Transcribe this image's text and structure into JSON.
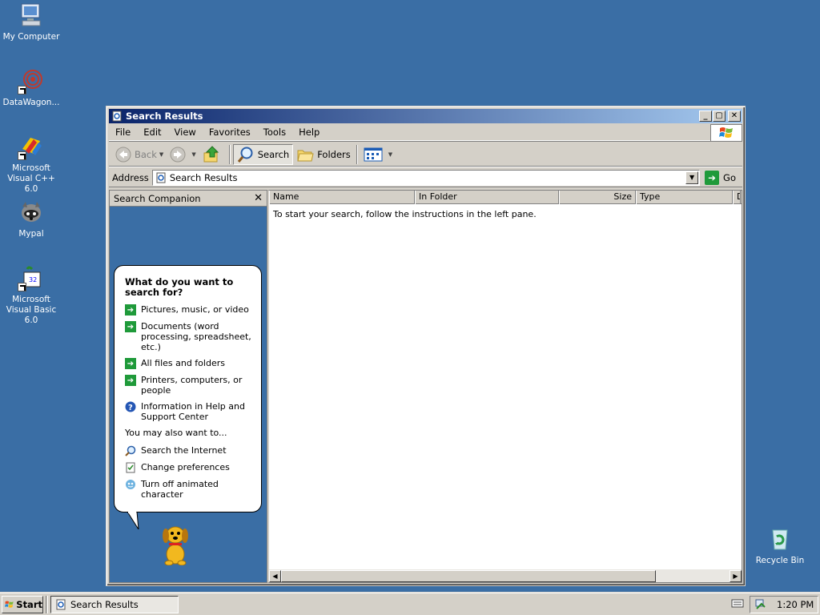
{
  "desktop": {
    "icons": [
      {
        "label": "My Computer",
        "icon": "my-computer-icon"
      },
      {
        "label": "DataWagon...",
        "icon": "datawagon-icon"
      },
      {
        "label": "Microsoft Visual C++ 6.0",
        "icon": "visual-cpp-icon"
      },
      {
        "label": "Mypal",
        "icon": "mypal-icon"
      },
      {
        "label": "Microsoft Visual Basic 6.0",
        "icon": "visual-basic-icon"
      },
      {
        "label": "Recycle Bin",
        "icon": "recycle-bin-icon"
      }
    ]
  },
  "window": {
    "title": "Search Results",
    "menu": [
      "File",
      "Edit",
      "View",
      "Favorites",
      "Tools",
      "Help"
    ],
    "toolbar": {
      "back": "Back",
      "search": "Search",
      "folders": "Folders"
    },
    "address": {
      "label": "Address",
      "value": "Search Results",
      "go": "Go"
    },
    "companion": {
      "header": "Search Companion",
      "question": "What do you want to search for?",
      "options": [
        "Pictures, music, or video",
        "Documents (word processing, spreadsheet, etc.)",
        "All files and folders",
        "Printers, computers, or people",
        "Information in Help and Support Center"
      ],
      "also_label": "You may also want to...",
      "also_options": [
        "Search the Internet",
        "Change preferences",
        "Turn off animated character"
      ]
    },
    "results": {
      "columns": [
        "Name",
        "In Folder",
        "Size",
        "Type",
        "D"
      ],
      "message": "To start your search, follow the instructions in the left pane."
    }
  },
  "taskbar": {
    "start": "Start",
    "task": "Search Results",
    "clock": "1:20 PM"
  },
  "colors": {
    "desktop": "#3a6ea5",
    "title_start": "#0a246a",
    "title_end": "#a6caf0",
    "chrome": "#d4d0c8",
    "go_green": "#1f9a3a"
  }
}
